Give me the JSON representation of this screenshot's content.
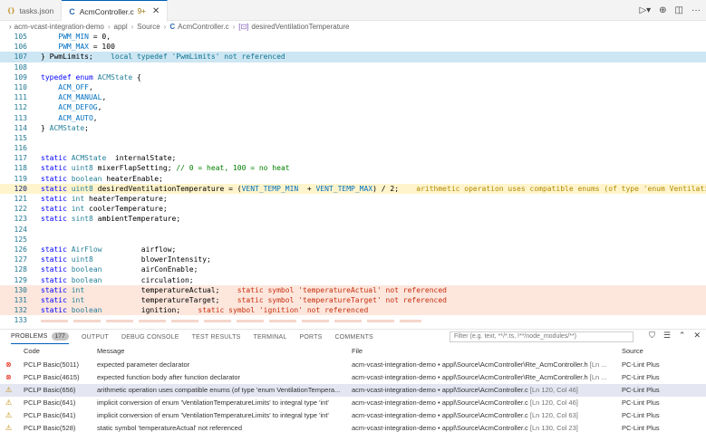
{
  "tabs": [
    {
      "label": "tasks.json",
      "icon": "json-icon",
      "active": false
    },
    {
      "label": "AcmController.c",
      "icon": "c-file-icon",
      "active": true,
      "modified": "9+"
    }
  ],
  "breadcrumb": [
    "acm-vcast-integration-demo",
    "appl",
    "Source",
    "AcmController.c",
    "desiredVentilationTemperature"
  ],
  "editor_lines": [
    {
      "n": "105",
      "html": "    PWM_MIN = 0,"
    },
    {
      "n": "106",
      "html": "    PWM_MAX = 100"
    },
    {
      "n": "107",
      "html": "} PwmLimits;    local typedef 'PwmLimits' not referenced",
      "hl": "blue"
    },
    {
      "n": "108",
      "html": ""
    },
    {
      "n": "109",
      "html": "typedef enum ACMState {"
    },
    {
      "n": "110",
      "html": "    ACM_OFF,"
    },
    {
      "n": "111",
      "html": "    ACM_MANUAL,"
    },
    {
      "n": "112",
      "html": "    ACM_DEFOG,"
    },
    {
      "n": "113",
      "html": "    ACM_AUTO,"
    },
    {
      "n": "114",
      "html": "} ACMState;"
    },
    {
      "n": "115",
      "html": ""
    },
    {
      "n": "116",
      "html": ""
    },
    {
      "n": "117",
      "html": "static ACMState  internalState;"
    },
    {
      "n": "118",
      "html": "static uint8 mixerFlapSetting; // 0 = heat, 100 = no heat"
    },
    {
      "n": "119",
      "html": "static boolean heaterEnable;"
    },
    {
      "n": "120",
      "html": "static uint8 desiredVentilationTemperature = (VENT_TEMP_MIN  + VENT_TEMP_MAX) / 2;    arithmetic operation uses compatible enums (of type 'enum VentilationTempera",
      "hl": "yellow"
    },
    {
      "n": "121",
      "html": "static int heaterTemperature;"
    },
    {
      "n": "122",
      "html": "static int coolerTemperature;"
    },
    {
      "n": "123",
      "html": "static sint8 ambientTemperature;"
    },
    {
      "n": "124",
      "html": ""
    },
    {
      "n": "125",
      "html": ""
    },
    {
      "n": "126",
      "html": "static AirFlow         airflow;"
    },
    {
      "n": "127",
      "html": "static uint8           blowerIntensity;"
    },
    {
      "n": "128",
      "html": "static boolean         airConEnable;"
    },
    {
      "n": "129",
      "html": "static boolean         circulation;"
    },
    {
      "n": "130",
      "html": "static int             temperatureActual;    static symbol 'temperatureActual' not referenced",
      "hl": "peach"
    },
    {
      "n": "131",
      "html": "static int             temperatureTarget;    static symbol 'temperatureTarget' not referenced",
      "hl": "peach"
    },
    {
      "n": "132",
      "html": "static boolean         ignition;    static symbol 'ignition' not referenced",
      "hl": "peach"
    },
    {
      "n": "133",
      "html": ""
    }
  ],
  "panel": {
    "tabs": [
      "PROBLEMS",
      "OUTPUT",
      "DEBUG CONSOLE",
      "TEST RESULTS",
      "TERMINAL",
      "PORTS",
      "COMMENTS"
    ],
    "problem_count": "177",
    "filter_placeholder": "Filter (e.g. text, **/*.ts, !**/node_modules/**)",
    "columns": {
      "code": "Code",
      "message": "Message",
      "file": "File",
      "source": "Source"
    },
    "rows": [
      {
        "sev": "error",
        "code": "PCLP Basic(5011)",
        "message": "expected parameter declarator",
        "file": "acm-vcast-integration-demo • appl\\Source\\AcmController\\Rte_AcmController.h",
        "loc": "[Ln ...",
        "source": "PC-Lint Plus"
      },
      {
        "sev": "error",
        "code": "PCLP Basic(4615)",
        "message": "expected function body after function declarator",
        "file": "acm-vcast-integration-demo • appl\\Source\\AcmController\\Rte_AcmController.h",
        "loc": "[Ln ...",
        "source": "PC-Lint Plus"
      },
      {
        "sev": "warning",
        "code": "PCLP Basic(656)",
        "message": "arithmetic operation uses compatible enums (of type 'enum VentilationTempera...",
        "file": "acm-vcast-integration-demo • appl\\Source\\AcmController.c",
        "loc": "[Ln 120, Col 46]",
        "source": "PC-Lint Plus",
        "selected": true
      },
      {
        "sev": "warning",
        "code": "PCLP Basic(641)",
        "message": "implicit conversion of enum 'VentilationTemperatureLimits' to integral type 'int'",
        "file": "acm-vcast-integration-demo • appl\\Source\\AcmController.c",
        "loc": "[Ln 120, Col 46]",
        "source": "PC-Lint Plus"
      },
      {
        "sev": "warning",
        "code": "PCLP Basic(641)",
        "message": "implicit conversion of enum 'VentilationTemperatureLimits' to integral type 'int'",
        "file": "acm-vcast-integration-demo • appl\\Source\\AcmController.c",
        "loc": "[Ln 120, Col 63]",
        "source": "PC-Lint Plus"
      },
      {
        "sev": "warning",
        "code": "PCLP Basic(528)",
        "message": "static symbol 'temperatureActual' not referenced",
        "file": "acm-vcast-integration-demo • appl\\Source\\AcmController.c",
        "loc": "[Ln 130, Col 23]",
        "source": "PC-Lint Plus"
      }
    ]
  }
}
